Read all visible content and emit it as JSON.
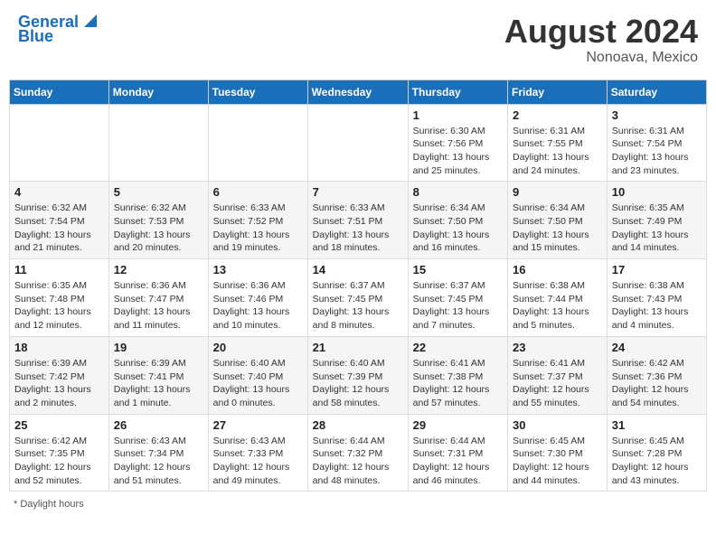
{
  "header": {
    "logo_line1": "General",
    "logo_line2": "Blue",
    "month_year": "August 2024",
    "location": "Nonoava, Mexico"
  },
  "days_of_week": [
    "Sunday",
    "Monday",
    "Tuesday",
    "Wednesday",
    "Thursday",
    "Friday",
    "Saturday"
  ],
  "footer": {
    "note": "Daylight hours"
  },
  "weeks": [
    [
      {
        "day": "",
        "info": ""
      },
      {
        "day": "",
        "info": ""
      },
      {
        "day": "",
        "info": ""
      },
      {
        "day": "",
        "info": ""
      },
      {
        "day": "1",
        "info": "Sunrise: 6:30 AM\nSunset: 7:56 PM\nDaylight: 13 hours and 25 minutes."
      },
      {
        "day": "2",
        "info": "Sunrise: 6:31 AM\nSunset: 7:55 PM\nDaylight: 13 hours and 24 minutes."
      },
      {
        "day": "3",
        "info": "Sunrise: 6:31 AM\nSunset: 7:54 PM\nDaylight: 13 hours and 23 minutes."
      }
    ],
    [
      {
        "day": "4",
        "info": "Sunrise: 6:32 AM\nSunset: 7:54 PM\nDaylight: 13 hours and 21 minutes."
      },
      {
        "day": "5",
        "info": "Sunrise: 6:32 AM\nSunset: 7:53 PM\nDaylight: 13 hours and 20 minutes."
      },
      {
        "day": "6",
        "info": "Sunrise: 6:33 AM\nSunset: 7:52 PM\nDaylight: 13 hours and 19 minutes."
      },
      {
        "day": "7",
        "info": "Sunrise: 6:33 AM\nSunset: 7:51 PM\nDaylight: 13 hours and 18 minutes."
      },
      {
        "day": "8",
        "info": "Sunrise: 6:34 AM\nSunset: 7:50 PM\nDaylight: 13 hours and 16 minutes."
      },
      {
        "day": "9",
        "info": "Sunrise: 6:34 AM\nSunset: 7:50 PM\nDaylight: 13 hours and 15 minutes."
      },
      {
        "day": "10",
        "info": "Sunrise: 6:35 AM\nSunset: 7:49 PM\nDaylight: 13 hours and 14 minutes."
      }
    ],
    [
      {
        "day": "11",
        "info": "Sunrise: 6:35 AM\nSunset: 7:48 PM\nDaylight: 13 hours and 12 minutes."
      },
      {
        "day": "12",
        "info": "Sunrise: 6:36 AM\nSunset: 7:47 PM\nDaylight: 13 hours and 11 minutes."
      },
      {
        "day": "13",
        "info": "Sunrise: 6:36 AM\nSunset: 7:46 PM\nDaylight: 13 hours and 10 minutes."
      },
      {
        "day": "14",
        "info": "Sunrise: 6:37 AM\nSunset: 7:45 PM\nDaylight: 13 hours and 8 minutes."
      },
      {
        "day": "15",
        "info": "Sunrise: 6:37 AM\nSunset: 7:45 PM\nDaylight: 13 hours and 7 minutes."
      },
      {
        "day": "16",
        "info": "Sunrise: 6:38 AM\nSunset: 7:44 PM\nDaylight: 13 hours and 5 minutes."
      },
      {
        "day": "17",
        "info": "Sunrise: 6:38 AM\nSunset: 7:43 PM\nDaylight: 13 hours and 4 minutes."
      }
    ],
    [
      {
        "day": "18",
        "info": "Sunrise: 6:39 AM\nSunset: 7:42 PM\nDaylight: 13 hours and 2 minutes."
      },
      {
        "day": "19",
        "info": "Sunrise: 6:39 AM\nSunset: 7:41 PM\nDaylight: 13 hours and 1 minute."
      },
      {
        "day": "20",
        "info": "Sunrise: 6:40 AM\nSunset: 7:40 PM\nDaylight: 13 hours and 0 minutes."
      },
      {
        "day": "21",
        "info": "Sunrise: 6:40 AM\nSunset: 7:39 PM\nDaylight: 12 hours and 58 minutes."
      },
      {
        "day": "22",
        "info": "Sunrise: 6:41 AM\nSunset: 7:38 PM\nDaylight: 12 hours and 57 minutes."
      },
      {
        "day": "23",
        "info": "Sunrise: 6:41 AM\nSunset: 7:37 PM\nDaylight: 12 hours and 55 minutes."
      },
      {
        "day": "24",
        "info": "Sunrise: 6:42 AM\nSunset: 7:36 PM\nDaylight: 12 hours and 54 minutes."
      }
    ],
    [
      {
        "day": "25",
        "info": "Sunrise: 6:42 AM\nSunset: 7:35 PM\nDaylight: 12 hours and 52 minutes."
      },
      {
        "day": "26",
        "info": "Sunrise: 6:43 AM\nSunset: 7:34 PM\nDaylight: 12 hours and 51 minutes."
      },
      {
        "day": "27",
        "info": "Sunrise: 6:43 AM\nSunset: 7:33 PM\nDaylight: 12 hours and 49 minutes."
      },
      {
        "day": "28",
        "info": "Sunrise: 6:44 AM\nSunset: 7:32 PM\nDaylight: 12 hours and 48 minutes."
      },
      {
        "day": "29",
        "info": "Sunrise: 6:44 AM\nSunset: 7:31 PM\nDaylight: 12 hours and 46 minutes."
      },
      {
        "day": "30",
        "info": "Sunrise: 6:45 AM\nSunset: 7:30 PM\nDaylight: 12 hours and 44 minutes."
      },
      {
        "day": "31",
        "info": "Sunrise: 6:45 AM\nSunset: 7:28 PM\nDaylight: 12 hours and 43 minutes."
      }
    ]
  ]
}
